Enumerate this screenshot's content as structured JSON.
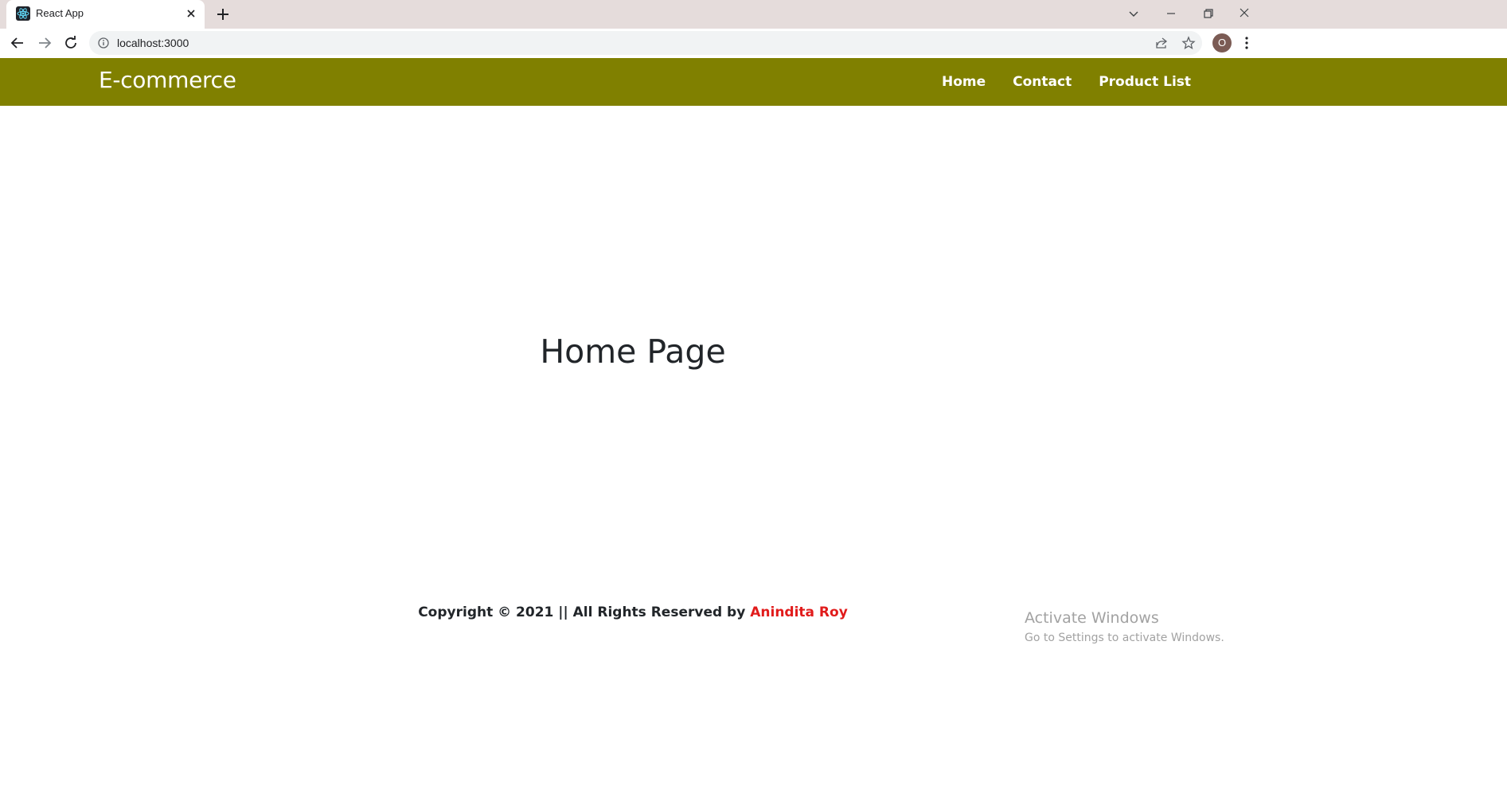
{
  "browser": {
    "tab_title": "React App",
    "url": "localhost:3000",
    "avatar_letter": "O"
  },
  "navbar": {
    "brand": "E-commerce",
    "links": [
      "Home",
      "Contact",
      "Product List"
    ],
    "bg_color": "#808000"
  },
  "main": {
    "heading": "Home Page"
  },
  "footer": {
    "text": "Copyright © 2021 || All Rights Reserved by ",
    "author": "Anindita Roy",
    "author_color": "#e11b1b"
  },
  "overlay": {
    "activate_title": "Activate Windows",
    "activate_subtitle": "Go to Settings to activate Windows."
  }
}
